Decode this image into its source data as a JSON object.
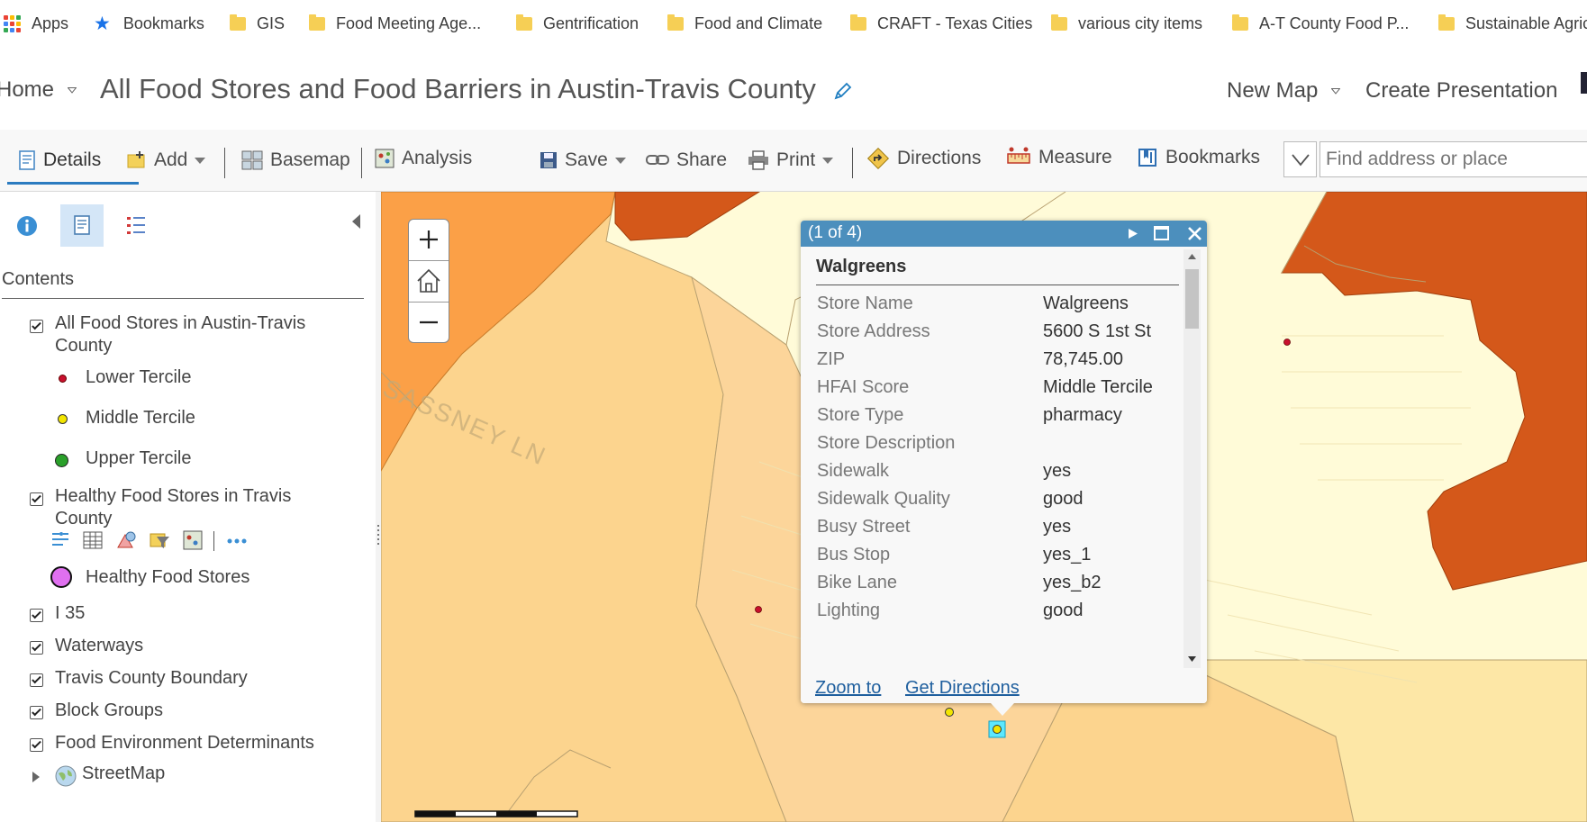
{
  "bookmarks_bar": {
    "items": [
      {
        "label": "Apps",
        "icon": "apps-icon"
      },
      {
        "label": "Bookmarks",
        "icon": "star-icon"
      },
      {
        "label": "GIS",
        "icon": "folder-icon"
      },
      {
        "label": "Food Meeting Age...",
        "icon": "folder-icon"
      },
      {
        "label": "Gentrification",
        "icon": "folder-icon"
      },
      {
        "label": "Food and Climate",
        "icon": "folder-icon"
      },
      {
        "label": "CRAFT - Texas Cities",
        "icon": "folder-icon"
      },
      {
        "label": "various city items",
        "icon": "folder-icon"
      },
      {
        "label": "A-T County Food P...",
        "icon": "folder-icon"
      },
      {
        "label": "Sustainable Agric",
        "icon": "folder-icon"
      }
    ]
  },
  "header": {
    "home_label": "Home",
    "map_title": "All Food Stores and Food Barriers in Austin-Travis County",
    "new_map_label": "New Map",
    "create_presentation_label": "Create Presentation"
  },
  "toolbar": {
    "details_label": "Details",
    "add_label": "Add",
    "basemap_label": "Basemap",
    "analysis_label": "Analysis",
    "save_label": "Save",
    "share_label": "Share",
    "print_label": "Print",
    "directions_label": "Directions",
    "measure_label": "Measure",
    "bookmarks_label": "Bookmarks",
    "search_placeholder": "Find address or place"
  },
  "contents": {
    "heading": "Contents",
    "layers": [
      {
        "label": "All Food Stores in Austin-Travis County",
        "checked": true,
        "legend": [
          {
            "label": "Lower Tercile",
            "color": "#c8102e"
          },
          {
            "label": "Middle Tercile",
            "color": "#f2e500"
          },
          {
            "label": "Upper Tercile",
            "color": "#2aa02a"
          }
        ]
      },
      {
        "label": "Healthy Food Stores in Travis County",
        "checked": true,
        "legend": [
          {
            "label": "Healthy Food Stores",
            "color": "#e070f0"
          }
        ]
      },
      {
        "label": "I 35",
        "checked": true
      },
      {
        "label": "Waterways",
        "checked": true
      },
      {
        "label": "Travis County Boundary",
        "checked": true
      },
      {
        "label": "Block Groups",
        "checked": true
      },
      {
        "label": "Food Environment Determinants",
        "checked": true
      },
      {
        "label": "StreetMap",
        "checked": false
      }
    ]
  },
  "map": {
    "street_label": "SASSNEY LN",
    "colors": {
      "light": "#fffbd8",
      "pale": "#fde7a6",
      "medium": "#fcd48e",
      "orange": "#fba047",
      "dark": "#d4581a"
    }
  },
  "popup": {
    "counter": "(1 of 4)",
    "title": "Walgreens",
    "fields": [
      {
        "k": "Store Name",
        "v": "Walgreens"
      },
      {
        "k": "Store Address",
        "v": "5600 S 1st St"
      },
      {
        "k": "ZIP",
        "v": "78,745.00"
      },
      {
        "k": "HFAI Score",
        "v": "Middle Tercile"
      },
      {
        "k": "Store Type",
        "v": "pharmacy"
      },
      {
        "k": "Store Description",
        "v": ""
      },
      {
        "k": "Sidewalk",
        "v": "yes"
      },
      {
        "k": "Sidewalk Quality",
        "v": "good"
      },
      {
        "k": "Busy Street",
        "v": "yes"
      },
      {
        "k": "Bus Stop",
        "v": "yes_1"
      },
      {
        "k": "Bike Lane",
        "v": "yes_b2"
      },
      {
        "k": "Lighting",
        "v": "good"
      }
    ],
    "zoom_to": "Zoom to",
    "get_directions": "Get Directions"
  }
}
